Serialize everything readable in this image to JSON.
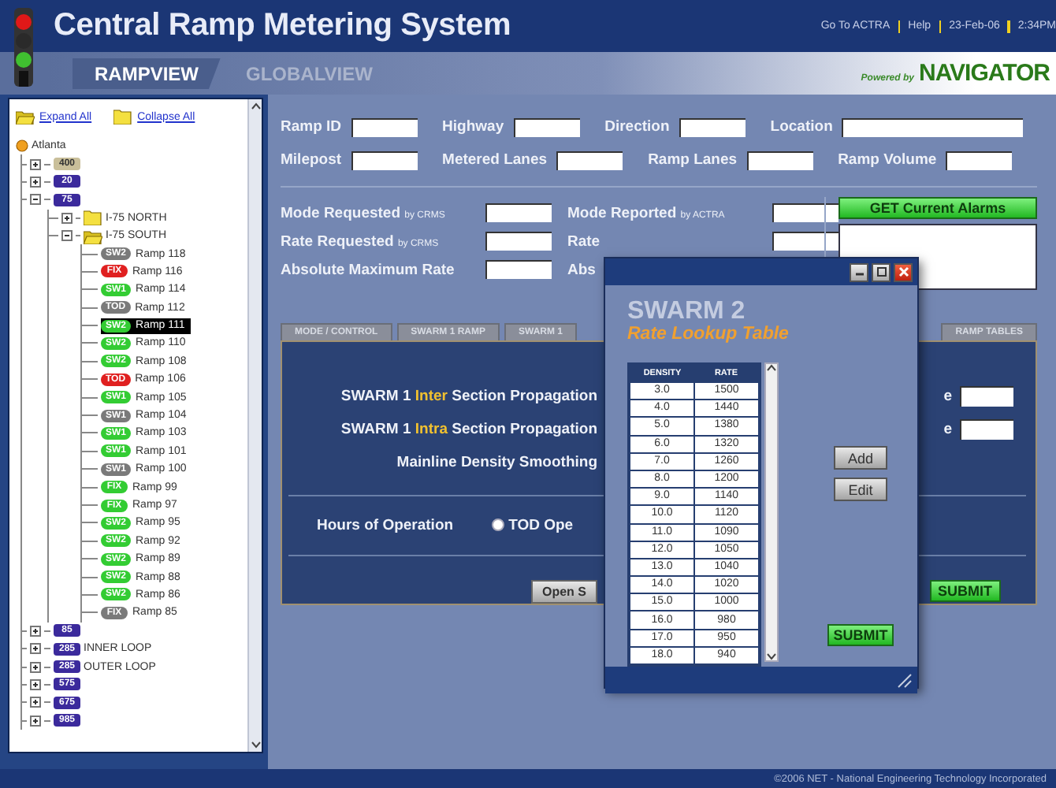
{
  "header": {
    "title": "Central Ramp Metering System",
    "links": [
      "Go To ACTRA",
      "Help",
      "23-Feb-06",
      "2:34PM"
    ],
    "nav_tabs": [
      {
        "label": "RAMPVIEW",
        "selected": true
      },
      {
        "label": "GLOBALVIEW",
        "selected": false
      }
    ],
    "powered_by": "Powered by",
    "brand": "NAVIGATOR"
  },
  "sidebar": {
    "actions": [
      "Expand All",
      "Collapse All"
    ],
    "tree": {
      "kind": "city",
      "label": "Atlanta",
      "children": [
        {
          "kind": "highway",
          "badge": "400",
          "color": "#c9bf9a",
          "expanded": false
        },
        {
          "kind": "highway",
          "badge": "20",
          "color": "#3b2a9c",
          "expanded": false
        },
        {
          "kind": "highway",
          "badge": "75",
          "color": "#3b2a9c",
          "expanded": true,
          "children": [
            {
              "kind": "folder",
              "label": "I-75 NORTH",
              "expanded": false
            },
            {
              "kind": "folder",
              "label": "I-75 SOUTH",
              "expanded": true,
              "children": [
                {
                  "kind": "ramp",
                  "badge": "SW2",
                  "color": "#7a7a7a",
                  "label": "Ramp 118",
                  "selected": false
                },
                {
                  "kind": "ramp",
                  "badge": "FIX",
                  "color": "#e02020",
                  "label": "Ramp 116",
                  "selected": false
                },
                {
                  "kind": "ramp",
                  "badge": "SW1",
                  "color": "#33cc33",
                  "label": "Ramp 114",
                  "selected": false
                },
                {
                  "kind": "ramp",
                  "badge": "TOD",
                  "color": "#7a7a7a",
                  "label": "Ramp 112",
                  "selected": false
                },
                {
                  "kind": "ramp",
                  "badge": "SW2",
                  "color": "#33cc33",
                  "label": "Ramp 111",
                  "selected": true
                },
                {
                  "kind": "ramp",
                  "badge": "SW2",
                  "color": "#33cc33",
                  "label": "Ramp 110",
                  "selected": false
                },
                {
                  "kind": "ramp",
                  "badge": "SW2",
                  "color": "#33cc33",
                  "label": "Ramp 108",
                  "selected": false
                },
                {
                  "kind": "ramp",
                  "badge": "TOD",
                  "color": "#e02020",
                  "label": "Ramp 106",
                  "selected": false
                },
                {
                  "kind": "ramp",
                  "badge": "SW1",
                  "color": "#33cc33",
                  "label": "Ramp 105",
                  "selected": false
                },
                {
                  "kind": "ramp",
                  "badge": "SW1",
                  "color": "#7a7a7a",
                  "label": "Ramp 104",
                  "selected": false
                },
                {
                  "kind": "ramp",
                  "badge": "SW1",
                  "color": "#33cc33",
                  "label": "Ramp 103",
                  "selected": false
                },
                {
                  "kind": "ramp",
                  "badge": "SW1",
                  "color": "#33cc33",
                  "label": "Ramp 101",
                  "selected": false
                },
                {
                  "kind": "ramp",
                  "badge": "SW1",
                  "color": "#7a7a7a",
                  "label": "Ramp 100",
                  "selected": false
                },
                {
                  "kind": "ramp",
                  "badge": "FIX",
                  "color": "#33cc33",
                  "label": "Ramp 99",
                  "selected": false
                },
                {
                  "kind": "ramp",
                  "badge": "FIX",
                  "color": "#33cc33",
                  "label": "Ramp 97",
                  "selected": false
                },
                {
                  "kind": "ramp",
                  "badge": "SW2",
                  "color": "#33cc33",
                  "label": "Ramp 95",
                  "selected": false
                },
                {
                  "kind": "ramp",
                  "badge": "SW2",
                  "color": "#33cc33",
                  "label": "Ramp 92",
                  "selected": false
                },
                {
                  "kind": "ramp",
                  "badge": "SW2",
                  "color": "#33cc33",
                  "label": "Ramp 89",
                  "selected": false
                },
                {
                  "kind": "ramp",
                  "badge": "SW2",
                  "color": "#33cc33",
                  "label": "Ramp 88",
                  "selected": false
                },
                {
                  "kind": "ramp",
                  "badge": "SW2",
                  "color": "#33cc33",
                  "label": "Ramp 86",
                  "selected": false
                },
                {
                  "kind": "ramp",
                  "badge": "FIX",
                  "color": "#7a7a7a",
                  "label": "Ramp 85",
                  "selected": false
                }
              ]
            }
          ]
        },
        {
          "kind": "highway",
          "badge": "85",
          "color": "#3b2a9c",
          "expanded": false
        },
        {
          "kind": "highway",
          "badge": "285",
          "color": "#3b2a9c",
          "label": "INNER LOOP",
          "expanded": false
        },
        {
          "kind": "highway",
          "badge": "285",
          "color": "#3b2a9c",
          "label": "OUTER LOOP",
          "expanded": false
        },
        {
          "kind": "highway",
          "badge": "575",
          "color": "#3b2a9c",
          "expanded": false
        },
        {
          "kind": "highway",
          "badge": "675",
          "color": "#3b2a9c",
          "expanded": false
        },
        {
          "kind": "highway",
          "badge": "985",
          "color": "#3b2a9c",
          "expanded": false
        }
      ]
    }
  },
  "ramp_fields": [
    {
      "label": "Ramp ID"
    },
    {
      "label": "Highway"
    },
    {
      "label": "Direction"
    },
    {
      "label": "Location"
    },
    {
      "label": "Milepost"
    },
    {
      "label": "Metered Lanes"
    },
    {
      "label": "Ramp Lanes"
    },
    {
      "label": "Ramp Volume"
    }
  ],
  "mode_fields": [
    {
      "label": "Mode Requested",
      "source": "by CRMS"
    },
    {
      "label": "Mode Reported",
      "source": "by ACTRA"
    },
    {
      "label": "Rate Requested",
      "source": "by CRMS"
    },
    {
      "label": "Rate"
    },
    {
      "label": "Absolute Maximum Rate"
    },
    {
      "label": "Abs"
    }
  ],
  "alarms_button": "GET Current Alarms",
  "tabs": [
    {
      "label": "MODE / CONTROL",
      "selected": false
    },
    {
      "label": "SWARM 1 RAMP",
      "selected": false
    },
    {
      "label": "SWARM 1",
      "selected": false
    },
    {
      "label": "RAMP TABLES",
      "selected": false
    }
  ],
  "swarm_rows": [
    {
      "segments": [
        {
          "text": "SWARM 1 ",
          "highlight": false
        },
        {
          "text": "Inter",
          "highlight": true
        },
        {
          "text": " Section Propagation",
          "highlight": false
        }
      ],
      "end_label": "e"
    },
    {
      "segments": [
        {
          "text": "SWARM 1 ",
          "highlight": false
        },
        {
          "text": "Intra",
          "highlight": true
        },
        {
          "text": " Section Propagation",
          "highlight": false
        }
      ],
      "end_label": "e"
    },
    {
      "segments": [
        {
          "text": "Mainline Density Smoothing",
          "highlight": false
        }
      ]
    }
  ],
  "hours": {
    "label": "Hours of Operation",
    "option": {
      "label": "TOD Ope",
      "checked": false
    }
  },
  "open_button": "Open S",
  "submit": "SUBMIT",
  "dialog": {
    "title": "SWARM 2",
    "subtitle": "Rate Lookup Table",
    "columns": [
      "DENSITY",
      "RATE"
    ],
    "rows": [
      [
        "3.0",
        "1500"
      ],
      [
        "4.0",
        "1440"
      ],
      [
        "5.0",
        "1380"
      ],
      [
        "6.0",
        "1320"
      ],
      [
        "7.0",
        "1260"
      ],
      [
        "8.0",
        "1200"
      ],
      [
        "9.0",
        "1140"
      ],
      [
        "10.0",
        "1120"
      ],
      [
        "11.0",
        "1090"
      ],
      [
        "12.0",
        "1050"
      ],
      [
        "13.0",
        "1040"
      ],
      [
        "14.0",
        "1020"
      ],
      [
        "15.0",
        "1000"
      ],
      [
        "16.0",
        "980"
      ],
      [
        "17.0",
        "950"
      ],
      [
        "18.0",
        "940"
      ]
    ],
    "buttons": [
      "Add",
      "Edit"
    ],
    "submit": "SUBMIT"
  },
  "footer": "©2006 NET - National Engineering Technology Incorporated"
}
